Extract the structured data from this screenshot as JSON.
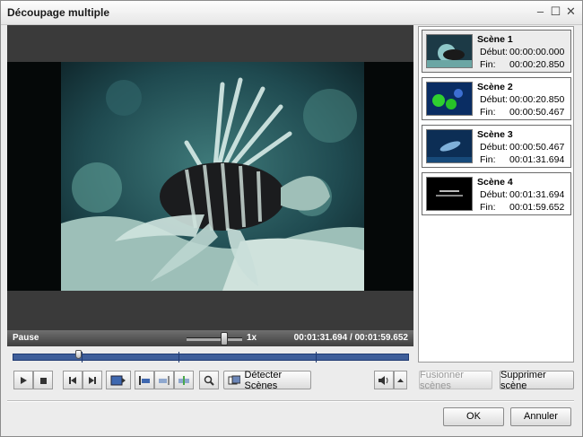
{
  "window": {
    "title": "Découpage multiple"
  },
  "status": {
    "label": "Pause",
    "speed": "1x",
    "time": "00:01:31.694  /  00:01:59.652"
  },
  "scenes": [
    {
      "name": "Scène 1",
      "debut_label": "Début:",
      "debut": "00:00:00.000",
      "fin_label": "Fin:",
      "fin": "00:00:20.850"
    },
    {
      "name": "Scène 2",
      "debut_label": "Début:",
      "debut": "00:00:20.850",
      "fin_label": "Fin:",
      "fin": "00:00:50.467"
    },
    {
      "name": "Scène 3",
      "debut_label": "Début:",
      "debut": "00:00:50.467",
      "fin_label": "Fin:",
      "fin": "00:01:31.694"
    },
    {
      "name": "Scène 4",
      "debut_label": "Début:",
      "debut": "00:01:31.694",
      "fin_label": "Fin:",
      "fin": "00:01:59.652"
    }
  ],
  "toolbar": {
    "detect_label": "Détecter Scènes",
    "merge_label": "Fusionner scènes",
    "delete_label": "Supprimer scène"
  },
  "footer": {
    "ok_label": "OK",
    "cancel_label": "Annuler"
  }
}
